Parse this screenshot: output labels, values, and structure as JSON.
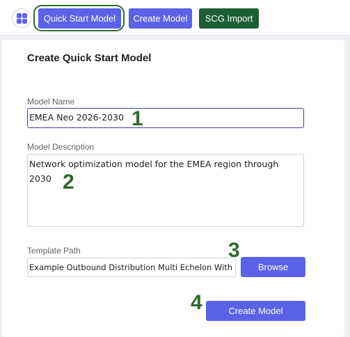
{
  "toolbar": {
    "menu_icon": "grid-apps-icon",
    "buttons": [
      {
        "label": "Quick Start Model",
        "color": "#5b62e8",
        "active": true
      },
      {
        "label": "Create Model",
        "color": "#5b62e8"
      },
      {
        "label": "SCG Import",
        "color": "#1e5e34"
      }
    ],
    "highlight_color": "#2e6b2e"
  },
  "form": {
    "title": "Create Quick Start Model",
    "model_name": {
      "label": "Model Name",
      "value": "EMEA Neo 2026-2030"
    },
    "model_description": {
      "label": "Model Description",
      "value": "Network optimization model for the EMEA region through\n2030"
    },
    "template_path": {
      "label": "Template Path",
      "value": "Example Outbound Distribution Multi Echelon With ...",
      "browse_label": "Browse"
    },
    "create_label": "Create Model"
  },
  "step_markers": [
    "1",
    "2",
    "3",
    "4"
  ]
}
